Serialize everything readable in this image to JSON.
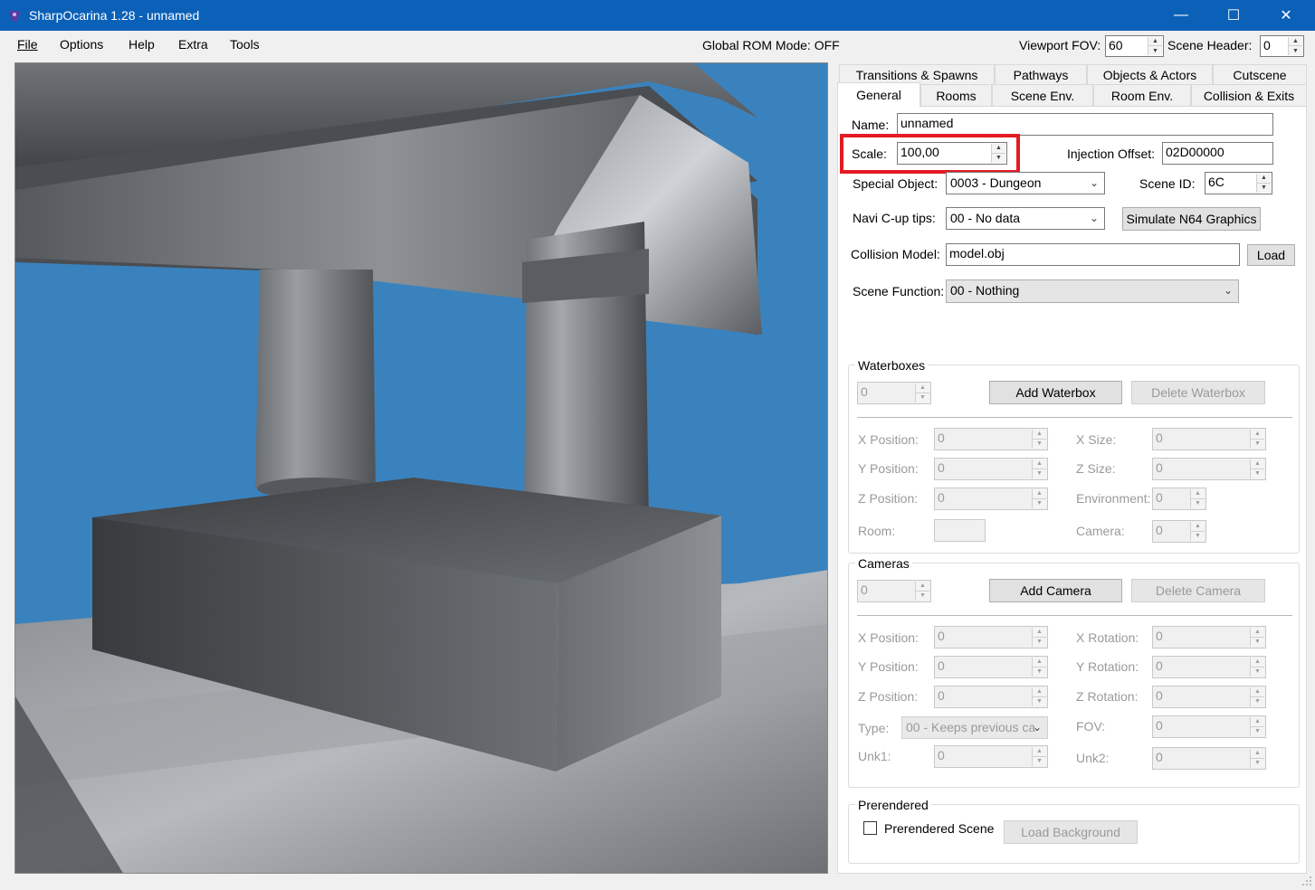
{
  "window": {
    "title": "SharpOcarina 1.28 - unnamed",
    "minimize": "—",
    "maximize": "☐",
    "close": "✕"
  },
  "menu": {
    "items": [
      "File",
      "Options",
      "Help",
      "Extra",
      "Tools"
    ]
  },
  "status": {
    "rom_mode": "Global ROM Mode: OFF"
  },
  "toolbar": {
    "viewport_fov_label": "Viewport FOV:",
    "viewport_fov": "60",
    "scene_header_label": "Scene Header:",
    "scene_header": "0"
  },
  "tabs": {
    "row1": [
      "Transitions & Spawns",
      "Pathways",
      "Objects & Actors",
      "Cutscene"
    ],
    "row2": [
      "General",
      "Rooms",
      "Scene Env.",
      "Room Env.",
      "Collision & Exits"
    ]
  },
  "general": {
    "name_label": "Name:",
    "name": "unnamed",
    "scale_label": "Scale:",
    "scale": "100,00",
    "injection_offset_label": "Injection Offset:",
    "injection_offset": "02D00000",
    "special_object_label": "Special Object:",
    "special_object": "0003 - Dungeon",
    "scene_id_label": "Scene ID:",
    "scene_id": "6C",
    "navi_label": "Navi C-up tips:",
    "navi": "00 - No data",
    "simulate_button": "Simulate N64 Graphics",
    "collision_model_label": "Collision Model:",
    "collision_model": "model.obj",
    "load_button": "Load",
    "scene_function_label": "Scene Function:",
    "scene_function": "00 - Nothing"
  },
  "waterboxes": {
    "title": "Waterboxes",
    "index": "0",
    "add": "Add Waterbox",
    "delete": "Delete Waterbox",
    "x_position_label": "X Position:",
    "x_position": "0",
    "y_position_label": "Y Position:",
    "y_position": "0",
    "z_position_label": "Z Position:",
    "z_position": "0",
    "room_label": "Room:",
    "x_size_label": "X Size:",
    "x_size": "0",
    "z_size_label": "Z Size:",
    "z_size": "0",
    "environment_label": "Environment:",
    "environment": "0",
    "camera_label": "Camera:",
    "camera": "0"
  },
  "cameras": {
    "title": "Cameras",
    "index": "0",
    "add": "Add Camera",
    "delete": "Delete Camera",
    "x_position_label": "X Position:",
    "x_position": "0",
    "y_position_label": "Y Position:",
    "y_position": "0",
    "z_position_label": "Z Position:",
    "z_position": "0",
    "type_label": "Type:",
    "type": "00 - Keeps previous ca",
    "unk1_label": "Unk1:",
    "unk1": "0",
    "x_rotation_label": "X Rotation:",
    "x_rotation": "0",
    "y_rotation_label": "Y Rotation:",
    "y_rotation": "0",
    "z_rotation_label": "Z Rotation:",
    "z_rotation": "0",
    "fov_label": "FOV:",
    "fov": "0",
    "unk2_label": "Unk2:",
    "unk2": "0"
  },
  "prerendered": {
    "title": "Prerendered",
    "checkbox_label": "Prerendered Scene",
    "load_background": "Load Background"
  },
  "colors": {
    "titlebar": "#0b61b7",
    "viewport_sky": "#3a82bd",
    "highlight": "#e31b23"
  }
}
